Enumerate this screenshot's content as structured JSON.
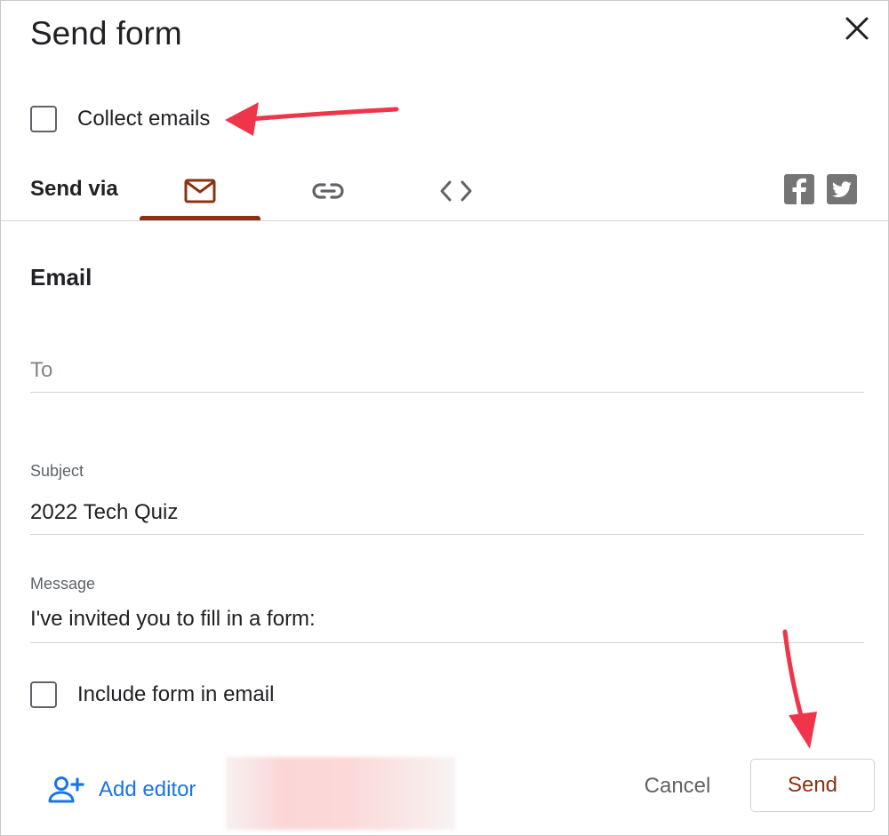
{
  "dialog": {
    "title": "Send form"
  },
  "collect_emails": {
    "label": "Collect emails",
    "checked": false
  },
  "send_via": {
    "label": "Send via",
    "tabs": [
      {
        "icon": "email-icon",
        "selected": true
      },
      {
        "icon": "link-icon",
        "selected": false
      },
      {
        "icon": "embed-code-icon",
        "selected": false
      }
    ],
    "share": [
      {
        "icon": "facebook-icon"
      },
      {
        "icon": "twitter-icon"
      }
    ]
  },
  "email": {
    "section_title": "Email",
    "to": {
      "placeholder": "To",
      "value": ""
    },
    "subject": {
      "label": "Subject",
      "value": "2022 Tech Quiz"
    },
    "message": {
      "label": "Message",
      "value": "I've invited you to fill in a form:"
    },
    "include_form": {
      "label": "Include form in email",
      "checked": false
    }
  },
  "footer": {
    "add_editor_label": "Add editor",
    "cancel_label": "Cancel",
    "send_label": "Send"
  },
  "colors": {
    "accent": "#8c3212",
    "link_blue": "#1a73e8",
    "annotation_red": "#f0354a"
  }
}
